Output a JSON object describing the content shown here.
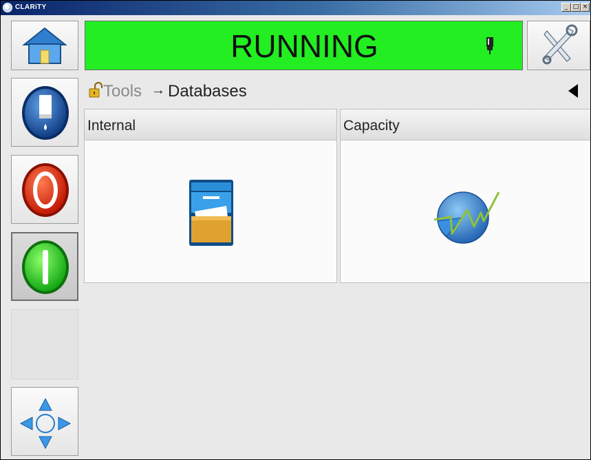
{
  "window": {
    "title": "CLARiTY",
    "min_label": "_",
    "max_label": "□",
    "close_label": "×"
  },
  "status": {
    "text": "RUNNING",
    "color": "#22ee22"
  },
  "breadcrumb": {
    "parent": "Tools",
    "separator": "→",
    "current": "Databases"
  },
  "tiles": [
    {
      "label": "Internal",
      "icon": "database-cabinet-icon"
    },
    {
      "label": "Capacity",
      "icon": "capacity-chart-icon"
    }
  ],
  "sidebar": {
    "buttons": [
      {
        "name": "home",
        "icon": "home-icon"
      },
      {
        "name": "printer-status",
        "icon": "ink-status-icon"
      },
      {
        "name": "stop",
        "icon": "stop-icon",
        "color": "#e03010"
      },
      {
        "name": "start",
        "icon": "start-icon",
        "color": "#22cc22",
        "pressed": true
      },
      {
        "name": "navigate",
        "icon": "navigation-arrows-icon"
      }
    ]
  },
  "colors": {
    "status_green": "#22ee22",
    "stop_red": "#e03010",
    "start_green": "#22cc22",
    "accent_blue": "#1f66b5"
  }
}
